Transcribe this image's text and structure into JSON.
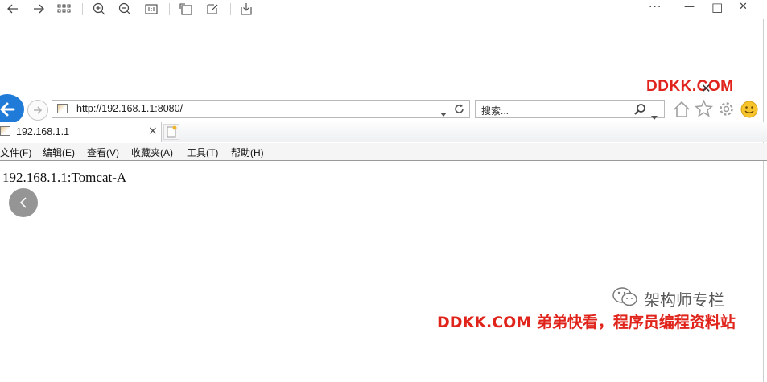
{
  "viewer": {
    "toolbar_icons": [
      "back-arrow-icon",
      "forward-arrow-icon",
      "grid-icon",
      "zoom-in-icon",
      "zoom-out-icon",
      "fit-icon",
      "rotate-icon",
      "edit-icon",
      "save-icon"
    ],
    "more_label": "···",
    "minimize_label": "—",
    "maximize_label": "□",
    "close_label": "✕"
  },
  "browser": {
    "url": "http://192.168.1.1:8080/",
    "search_placeholder": "搜索...",
    "tab_title": "192.168.1.1",
    "tab_close": "×",
    "menu": [
      "文件(F)",
      "编辑(E)",
      "查看(V)",
      "收藏夹(A)",
      "工具(T)",
      "帮助(H)"
    ],
    "page_content": "192.168.1.1:Tomcat-A",
    "accent_color": "#1f7ad8"
  },
  "watermarks": {
    "top": "DDKK.COM",
    "bottom": "DDKK.COM 弟弟快看，程序员编程资料站",
    "wechat": "架构师专栏",
    "color": "#e0241b"
  }
}
